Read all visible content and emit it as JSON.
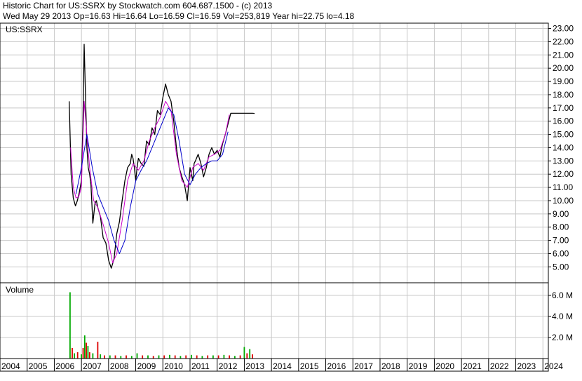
{
  "header": {
    "line1": "Historic Chart for US:SSRX by Stockwatch.com 604.687.1500 - (c) 2013",
    "line2": "Wed May 29 2013  Op=16.63  Hi=16.64  Lo=16.59  Cl=16.59  Vol=253,819  Year hi=22.75  lo=4.18"
  },
  "chart_data": [
    {
      "type": "line",
      "title": "US:SSRX",
      "xlabel": "",
      "ylabel": "",
      "y_ticks": [
        "5.00",
        "6.00",
        "7.00",
        "8.00",
        "9.00",
        "10.00",
        "11.00",
        "12.00",
        "13.00",
        "14.00",
        "15.00",
        "16.00",
        "17.00",
        "18.00",
        "19.00",
        "20.00",
        "21.00",
        "22.00",
        "23.00"
      ],
      "ylim": [
        3.8,
        23.4
      ],
      "xlim": [
        2004.0,
        2024.2
      ],
      "grid": true,
      "series": [
        {
          "color": "#000000",
          "x": [
            2006.55,
            2006.62,
            2006.7,
            2006.78,
            2006.85,
            2006.92,
            2007.0,
            2007.05,
            2007.1,
            2007.15,
            2007.2,
            2007.25,
            2007.3,
            2007.35,
            2007.42,
            2007.5,
            2007.55,
            2007.6,
            2007.7,
            2007.8,
            2007.9,
            2008.0,
            2008.05,
            2008.1,
            2008.2,
            2008.3,
            2008.4,
            2008.5,
            2008.6,
            2008.7,
            2008.8,
            2008.85,
            2008.9,
            2008.95,
            2009.0,
            2009.05,
            2009.1,
            2009.2,
            2009.3,
            2009.4,
            2009.5,
            2009.6,
            2009.7,
            2009.8,
            2009.9,
            2010.0,
            2010.1,
            2010.2,
            2010.3,
            2010.4,
            2010.5,
            2010.6,
            2010.7,
            2010.8,
            2010.9,
            2011.0,
            2011.05,
            2011.1,
            2011.15,
            2011.2,
            2011.3,
            2011.4,
            2011.5,
            2011.6,
            2011.7,
            2011.8,
            2011.9,
            2012.0,
            2012.1,
            2012.2,
            2012.3,
            2012.4,
            2012.5,
            2012.6,
            2012.7,
            2012.8,
            2012.9,
            2013.0,
            2013.1,
            2013.2,
            2013.3,
            2013.38
          ],
          "values": [
            17.5,
            12.0,
            10.2,
            9.6,
            10.0,
            10.6,
            11.5,
            15.5,
            21.8,
            18.0,
            14.0,
            12.5,
            12.0,
            11.2,
            8.3,
            9.8,
            10.0,
            9.5,
            8.8,
            7.2,
            6.8,
            5.5,
            5.2,
            4.9,
            5.6,
            7.5,
            8.4,
            10.0,
            11.5,
            12.5,
            12.8,
            13.5,
            13.2,
            12.5,
            11.5,
            12.5,
            13.2,
            12.8,
            12.6,
            14.5,
            14.2,
            15.5,
            15.0,
            16.8,
            16.5,
            17.8,
            18.8,
            18.0,
            17.5,
            16.0,
            14.0,
            12.5,
            11.8,
            11.2,
            10.0,
            12.5,
            12.0,
            11.5,
            12.8,
            13.0,
            13.5,
            12.8,
            11.8,
            12.5,
            13.5,
            14.0,
            13.5,
            13.8,
            13.3,
            14.3,
            15.0,
            15.8,
            16.6,
            16.6,
            16.6,
            16.6,
            16.6,
            16.6,
            16.6,
            16.6,
            16.6,
            16.59
          ]
        },
        {
          "color": "#cc00cc",
          "x": [
            2006.6,
            2006.7,
            2006.8,
            2006.9,
            2007.0,
            2007.1,
            2007.2,
            2007.3,
            2007.45,
            2007.6,
            2007.8,
            2008.0,
            2008.15,
            2008.3,
            2008.5,
            2008.7,
            2008.9,
            2009.1,
            2009.3,
            2009.5,
            2009.7,
            2009.9,
            2010.1,
            2010.3,
            2010.5,
            2010.7,
            2010.9,
            2011.1,
            2011.3,
            2011.5,
            2011.7,
            2011.9,
            2012.1,
            2012.3,
            2012.45
          ],
          "values": [
            14.0,
            11.0,
            10.2,
            10.3,
            11.0,
            17.5,
            15.0,
            12.5,
            10.0,
            9.5,
            8.2,
            6.8,
            5.3,
            6.0,
            8.5,
            11.5,
            12.8,
            12.3,
            13.0,
            14.5,
            15.5,
            16.3,
            17.5,
            16.8,
            13.5,
            11.5,
            11.0,
            12.5,
            12.8,
            12.3,
            13.3,
            13.5,
            13.8,
            15.0,
            16.5
          ]
        },
        {
          "color": "#0000cc",
          "x": [
            2006.8,
            2007.0,
            2007.2,
            2007.4,
            2007.6,
            2007.8,
            2008.0,
            2008.2,
            2008.4,
            2008.6,
            2008.8,
            2009.0,
            2009.2,
            2009.4,
            2009.6,
            2009.8,
            2010.0,
            2010.2,
            2010.4,
            2010.6,
            2010.8,
            2011.0,
            2011.2,
            2011.4,
            2011.6,
            2011.8,
            2012.0,
            2012.2,
            2012.4
          ],
          "values": [
            10.5,
            12.5,
            15.0,
            12.5,
            10.5,
            9.5,
            8.5,
            7.0,
            6.0,
            7.0,
            9.5,
            11.5,
            12.3,
            13.0,
            14.0,
            15.0,
            16.0,
            17.0,
            16.5,
            14.5,
            12.0,
            11.2,
            12.0,
            12.5,
            12.8,
            13.0,
            13.0,
            13.5,
            15.2
          ]
        }
      ]
    },
    {
      "type": "bar",
      "title": "Volume",
      "y_ticks": [
        "2.0 M",
        "4.0 M",
        "6.0 M"
      ],
      "ylim": [
        0,
        7.2
      ],
      "x_ticks": [
        "2004",
        "2005",
        "2006",
        "2007",
        "2008",
        "2009",
        "2010",
        "2011",
        "2012",
        "2013",
        "2014",
        "2015",
        "2016",
        "2017",
        "2018",
        "2019",
        "2020",
        "2021",
        "2022",
        "2023",
        "2024"
      ],
      "bars": [
        {
          "x": 2006.58,
          "value": 6.3,
          "color": "#00aa00"
        },
        {
          "x": 2006.66,
          "value": 1.0,
          "color": "#dd0000"
        },
        {
          "x": 2006.74,
          "value": 0.5,
          "color": "#00aa00"
        },
        {
          "x": 2006.86,
          "value": 0.6,
          "color": "#dd0000"
        },
        {
          "x": 2007.0,
          "value": 0.4,
          "color": "#00aa00"
        },
        {
          "x": 2007.06,
          "value": 1.0,
          "color": "#dd0000"
        },
        {
          "x": 2007.12,
          "value": 2.2,
          "color": "#00aa00"
        },
        {
          "x": 2007.18,
          "value": 1.5,
          "color": "#dd0000"
        },
        {
          "x": 2007.24,
          "value": 1.2,
          "color": "#00aa00"
        },
        {
          "x": 2007.3,
          "value": 0.6,
          "color": "#dd0000"
        },
        {
          "x": 2007.42,
          "value": 0.5,
          "color": "#00aa00"
        },
        {
          "x": 2007.6,
          "value": 1.6,
          "color": "#dd0000"
        },
        {
          "x": 2007.7,
          "value": 0.4,
          "color": "#00aa00"
        },
        {
          "x": 2007.85,
          "value": 0.3,
          "color": "#dd0000"
        },
        {
          "x": 2008.05,
          "value": 0.3,
          "color": "#00aa00"
        },
        {
          "x": 2008.25,
          "value": 0.3,
          "color": "#dd0000"
        },
        {
          "x": 2008.45,
          "value": 0.25,
          "color": "#00aa00"
        },
        {
          "x": 2008.65,
          "value": 0.3,
          "color": "#dd0000"
        },
        {
          "x": 2008.85,
          "value": 0.25,
          "color": "#00aa00"
        },
        {
          "x": 2009.05,
          "value": 0.5,
          "color": "#00aa00"
        },
        {
          "x": 2009.25,
          "value": 0.3,
          "color": "#dd0000"
        },
        {
          "x": 2009.45,
          "value": 0.3,
          "color": "#00aa00"
        },
        {
          "x": 2009.65,
          "value": 0.25,
          "color": "#dd0000"
        },
        {
          "x": 2009.85,
          "value": 0.3,
          "color": "#00aa00"
        },
        {
          "x": 2010.05,
          "value": 0.3,
          "color": "#dd0000"
        },
        {
          "x": 2010.25,
          "value": 0.35,
          "color": "#00aa00"
        },
        {
          "x": 2010.45,
          "value": 0.3,
          "color": "#dd0000"
        },
        {
          "x": 2010.65,
          "value": 0.25,
          "color": "#00aa00"
        },
        {
          "x": 2010.85,
          "value": 0.3,
          "color": "#dd0000"
        },
        {
          "x": 2011.05,
          "value": 0.35,
          "color": "#00aa00"
        },
        {
          "x": 2011.25,
          "value": 0.3,
          "color": "#dd0000"
        },
        {
          "x": 2011.45,
          "value": 0.25,
          "color": "#00aa00"
        },
        {
          "x": 2011.65,
          "value": 0.3,
          "color": "#dd0000"
        },
        {
          "x": 2011.85,
          "value": 0.3,
          "color": "#00aa00"
        },
        {
          "x": 2012.05,
          "value": 0.3,
          "color": "#dd0000"
        },
        {
          "x": 2012.25,
          "value": 0.35,
          "color": "#00aa00"
        },
        {
          "x": 2012.45,
          "value": 0.3,
          "color": "#dd0000"
        },
        {
          "x": 2012.65,
          "value": 0.25,
          "color": "#00aa00"
        },
        {
          "x": 2012.85,
          "value": 0.3,
          "color": "#dd0000"
        },
        {
          "x": 2013.0,
          "value": 1.1,
          "color": "#00aa00"
        },
        {
          "x": 2013.1,
          "value": 0.5,
          "color": "#dd0000"
        },
        {
          "x": 2013.2,
          "value": 0.9,
          "color": "#00aa00"
        },
        {
          "x": 2013.3,
          "value": 0.4,
          "color": "#dd0000"
        }
      ]
    }
  ]
}
